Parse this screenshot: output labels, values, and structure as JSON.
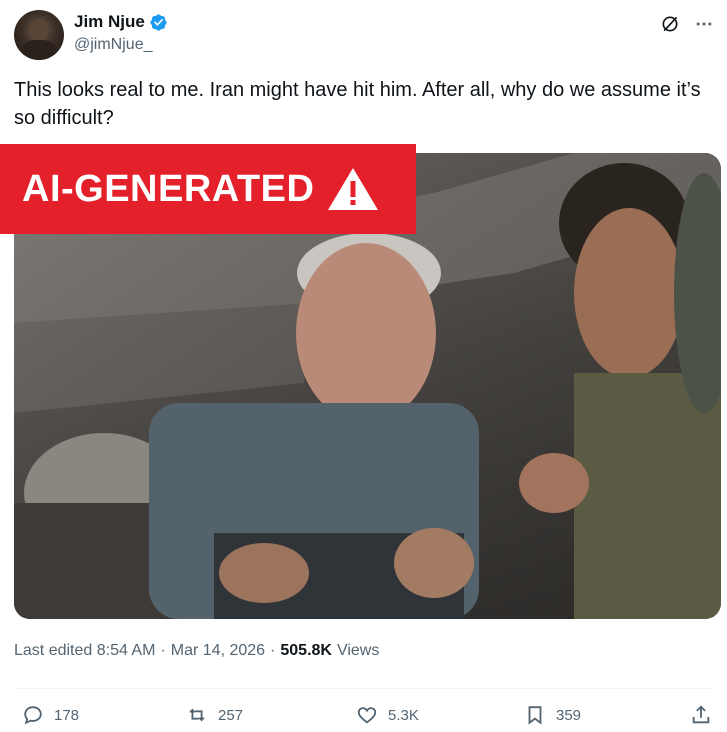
{
  "author": {
    "display_name": "Jim Njue",
    "handle": "@jimNjue_",
    "verified_icon": "verified-badge-icon"
  },
  "tweet": {
    "text": "This looks real to me. Iran might have hit him. After all, why do we assume it’s so difficult?"
  },
  "media": {
    "banner_label": "AI-GENERATED",
    "banner_color": "#e4202a",
    "banner_icon": "warning-triangle-icon"
  },
  "meta": {
    "edited": "Last edited 8:54 AM",
    "dot1": "·",
    "date": "Mar 14, 2026",
    "dot2": "·",
    "views_count": "505.8K",
    "views_label": "Views"
  },
  "actions": {
    "replies": "178",
    "reposts": "257",
    "likes": "5.3K",
    "bookmarks": "359"
  },
  "colors": {
    "text": "#0f1419",
    "secondary": "#536471",
    "verified": "#1d9bf0"
  }
}
